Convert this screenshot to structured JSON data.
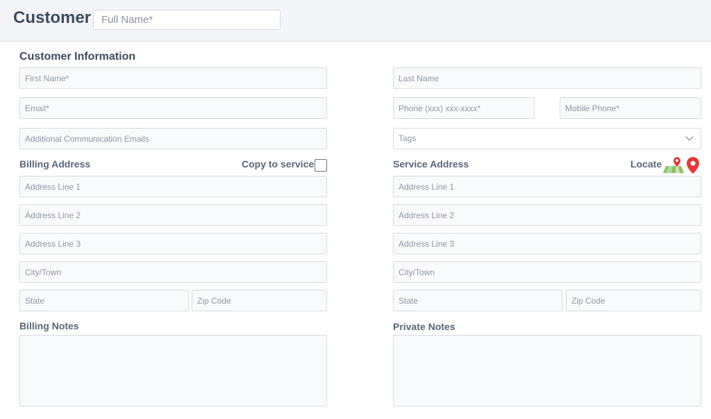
{
  "header": {
    "title": "Customer",
    "full_name_placeholder": "Full Name*"
  },
  "customer_info": {
    "title": "Customer Information",
    "first_name_placeholder": "First Name*",
    "last_name_placeholder": "Last Name",
    "email_placeholder": "Email*",
    "phone_placeholder": "Phone (xxx) xxx-xxxx*",
    "mobile_placeholder": "Mobile Phone*",
    "additional_emails_placeholder": "Additional Communication Emails",
    "tags_placeholder": "Tags"
  },
  "billing": {
    "title": "Billing Address",
    "copy_label": "Copy to service",
    "address1": "Address Line 1",
    "address2": "Address Line 2",
    "address3": "Address Line 3",
    "city": "City/Town",
    "state": "State",
    "zip": "Zip Code",
    "notes_label": "Billing Notes"
  },
  "service": {
    "title": "Service Address",
    "locate_label": "Locate",
    "address1": "Address Line 1",
    "address2": "Address Line 2",
    "address3": "Address Line 3",
    "city": "City/Town",
    "state": "State",
    "zip": "Zip Code",
    "notes_label": "Private Notes"
  },
  "icons": {
    "map": "map-icon",
    "pin": "map-pin-icon",
    "chevron": "chevron-down-icon"
  }
}
